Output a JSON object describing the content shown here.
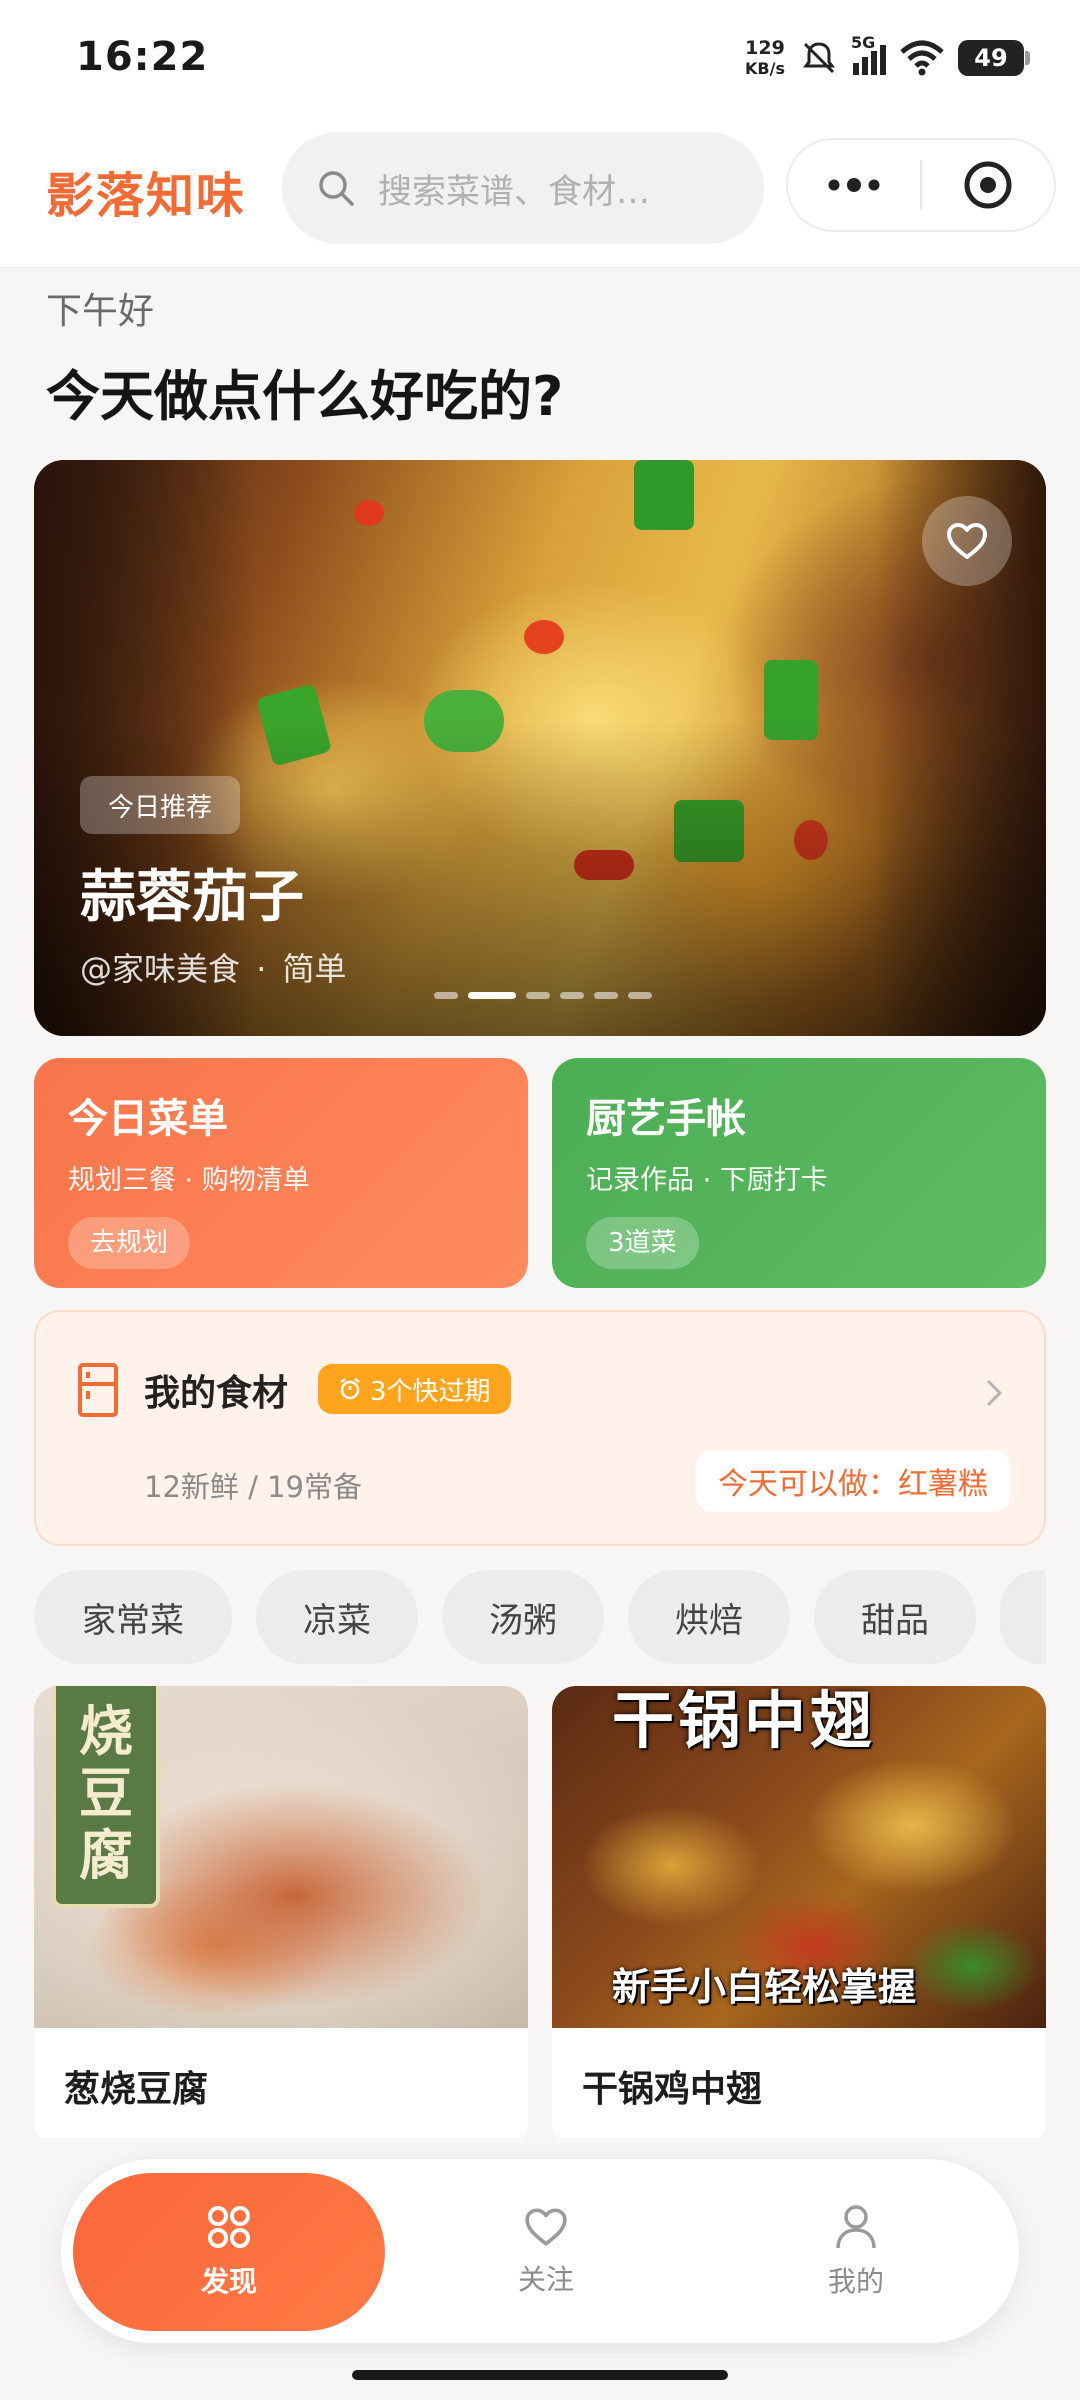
{
  "status_bar": {
    "time": "16:22",
    "net_speed_value": "129",
    "net_speed_unit": "KB/s",
    "signal_label": "5G",
    "battery": "49"
  },
  "header": {
    "brand": "影落知味",
    "search_placeholder": "搜索菜谱、食材…"
  },
  "greeting": {
    "subtitle": "下午好",
    "title": "今天做点什么好吃的?"
  },
  "hero": {
    "tag": "今日推荐",
    "title": "蒜蓉茄子",
    "author": "@家味美食",
    "separator": "·",
    "difficulty": "简单",
    "slide_count": 6,
    "active_slide": 2
  },
  "cards": {
    "menu": {
      "title": "今日菜单",
      "subtitle": "规划三餐 · 购物清单",
      "action": "去规划"
    },
    "journal": {
      "title": "厨艺手帐",
      "subtitle": "记录作品 · 下厨打卡",
      "badge": "3道菜"
    }
  },
  "ingredients": {
    "title": "我的食材",
    "expire_badge": "3个快过期",
    "stats": "12新鲜 / 19常备",
    "suggestion": "今天可以做：红薯糕"
  },
  "categories": [
    "家常菜",
    "凉菜",
    "汤粥",
    "烘焙",
    "甜品"
  ],
  "recipes": [
    {
      "name": "葱烧豆腐",
      "image_overlay_text": [
        "烧",
        "豆",
        "腐"
      ]
    },
    {
      "name": "干锅鸡中翅",
      "image_overlay_top": "干锅中翅",
      "image_overlay_bottom": "新手小白轻松掌握"
    }
  ],
  "bottom_nav": {
    "discover": "发现",
    "follow": "关注",
    "mine": "我的"
  },
  "colors": {
    "brand_orange": "#f36b34",
    "card_green": "#4cad54",
    "expire_badge": "#ffa41c"
  }
}
